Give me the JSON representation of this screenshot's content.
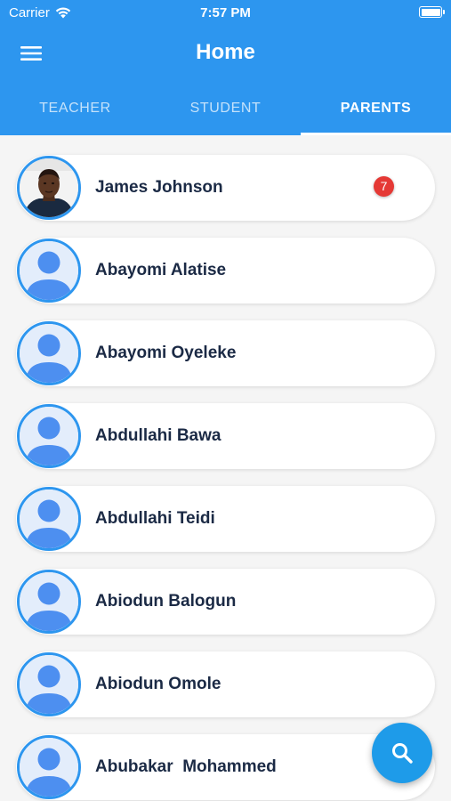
{
  "status_bar": {
    "carrier": "Carrier",
    "time": "7:57 PM"
  },
  "app_bar": {
    "title": "Home",
    "menu_icon": "menu-icon"
  },
  "tabs": [
    {
      "label": "TEACHER",
      "active": false
    },
    {
      "label": "STUDENT",
      "active": false
    },
    {
      "label": "PARENTS",
      "active": true
    }
  ],
  "contacts": [
    {
      "name": "James Johnson",
      "avatar": "photo",
      "badge": "7"
    },
    {
      "name": "Abayomi Alatise",
      "avatar": "default-avatar"
    },
    {
      "name": "Abayomi Oyeleke",
      "avatar": "default-avatar"
    },
    {
      "name": "Abdullahi Bawa",
      "avatar": "default-avatar"
    },
    {
      "name": "Abdullahi Teidi",
      "avatar": "default-avatar"
    },
    {
      "name": "Abiodun Balogun",
      "avatar": "default-avatar"
    },
    {
      "name": "Abiodun Omole",
      "avatar": "default-avatar"
    },
    {
      "name": "Abubakar  Mohammed",
      "avatar": "default-avatar"
    }
  ],
  "fab": {
    "icon": "search-icon"
  },
  "colors": {
    "primary": "#2d96ef",
    "badge": "#e53935",
    "fab": "#1e9be9",
    "name_text": "#1b2a45"
  }
}
